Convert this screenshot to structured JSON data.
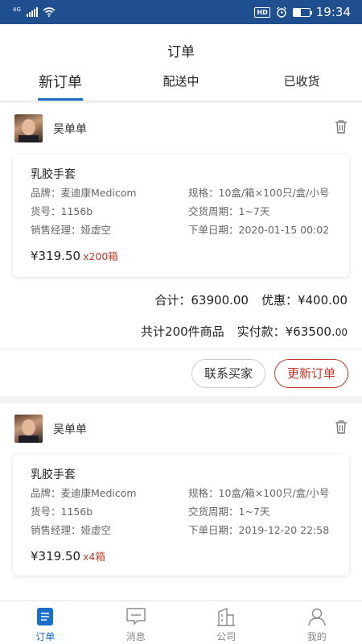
{
  "status_bar": {
    "network": "4G",
    "time": "19:34",
    "hd": "HD",
    "battery_level": 0.45
  },
  "header": {
    "title": "订单",
    "tabs": [
      {
        "label": "新订单",
        "active": true
      },
      {
        "label": "配送中",
        "active": false
      },
      {
        "label": "已收货",
        "active": false
      }
    ]
  },
  "orders": [
    {
      "buyer": "吴单单",
      "product": "乳胶手套",
      "brand": "品牌：麦迪康Medicom",
      "spec": "规格：10盒/箱×100只/盒/小号",
      "sku": "货号：1156b",
      "delivery": "交货周期：1~7天",
      "manager": "销售经理：娅虚空",
      "date": "下单日期：2020-01-15 00:02",
      "price": "¥319.50",
      "qty": "x200箱",
      "total": "合计：63900.00",
      "discount": "优惠：¥400.00",
      "count": "共计200件商品",
      "paid_label": "实付款：",
      "paid_main": "¥63500.",
      "paid_decimal": "00",
      "contact_button": "联系买家",
      "update_button": "更新订单"
    },
    {
      "buyer": "吴单单",
      "product": "乳胶手套",
      "brand": "品牌：麦迪康Medicom",
      "spec": "规格：10盒/箱×100只/盒/小号",
      "sku": "货号：1156b",
      "delivery": "交货周期：1~7天",
      "manager": "销售经理：娅虚空",
      "date": "下单日期：2019-12-20 22:58",
      "price": "¥319.50",
      "qty": "x4箱"
    }
  ],
  "bottom_nav": [
    {
      "label": "订单",
      "icon": "order-icon",
      "active": true
    },
    {
      "label": "消息",
      "icon": "message-icon",
      "active": false
    },
    {
      "label": "公司",
      "icon": "company-icon",
      "active": false
    },
    {
      "label": "我的",
      "icon": "profile-icon",
      "active": false
    }
  ],
  "colors": {
    "status_bar": "#1f4f8f",
    "accent": "#1c6fc7",
    "highlight": "#c0392b"
  }
}
